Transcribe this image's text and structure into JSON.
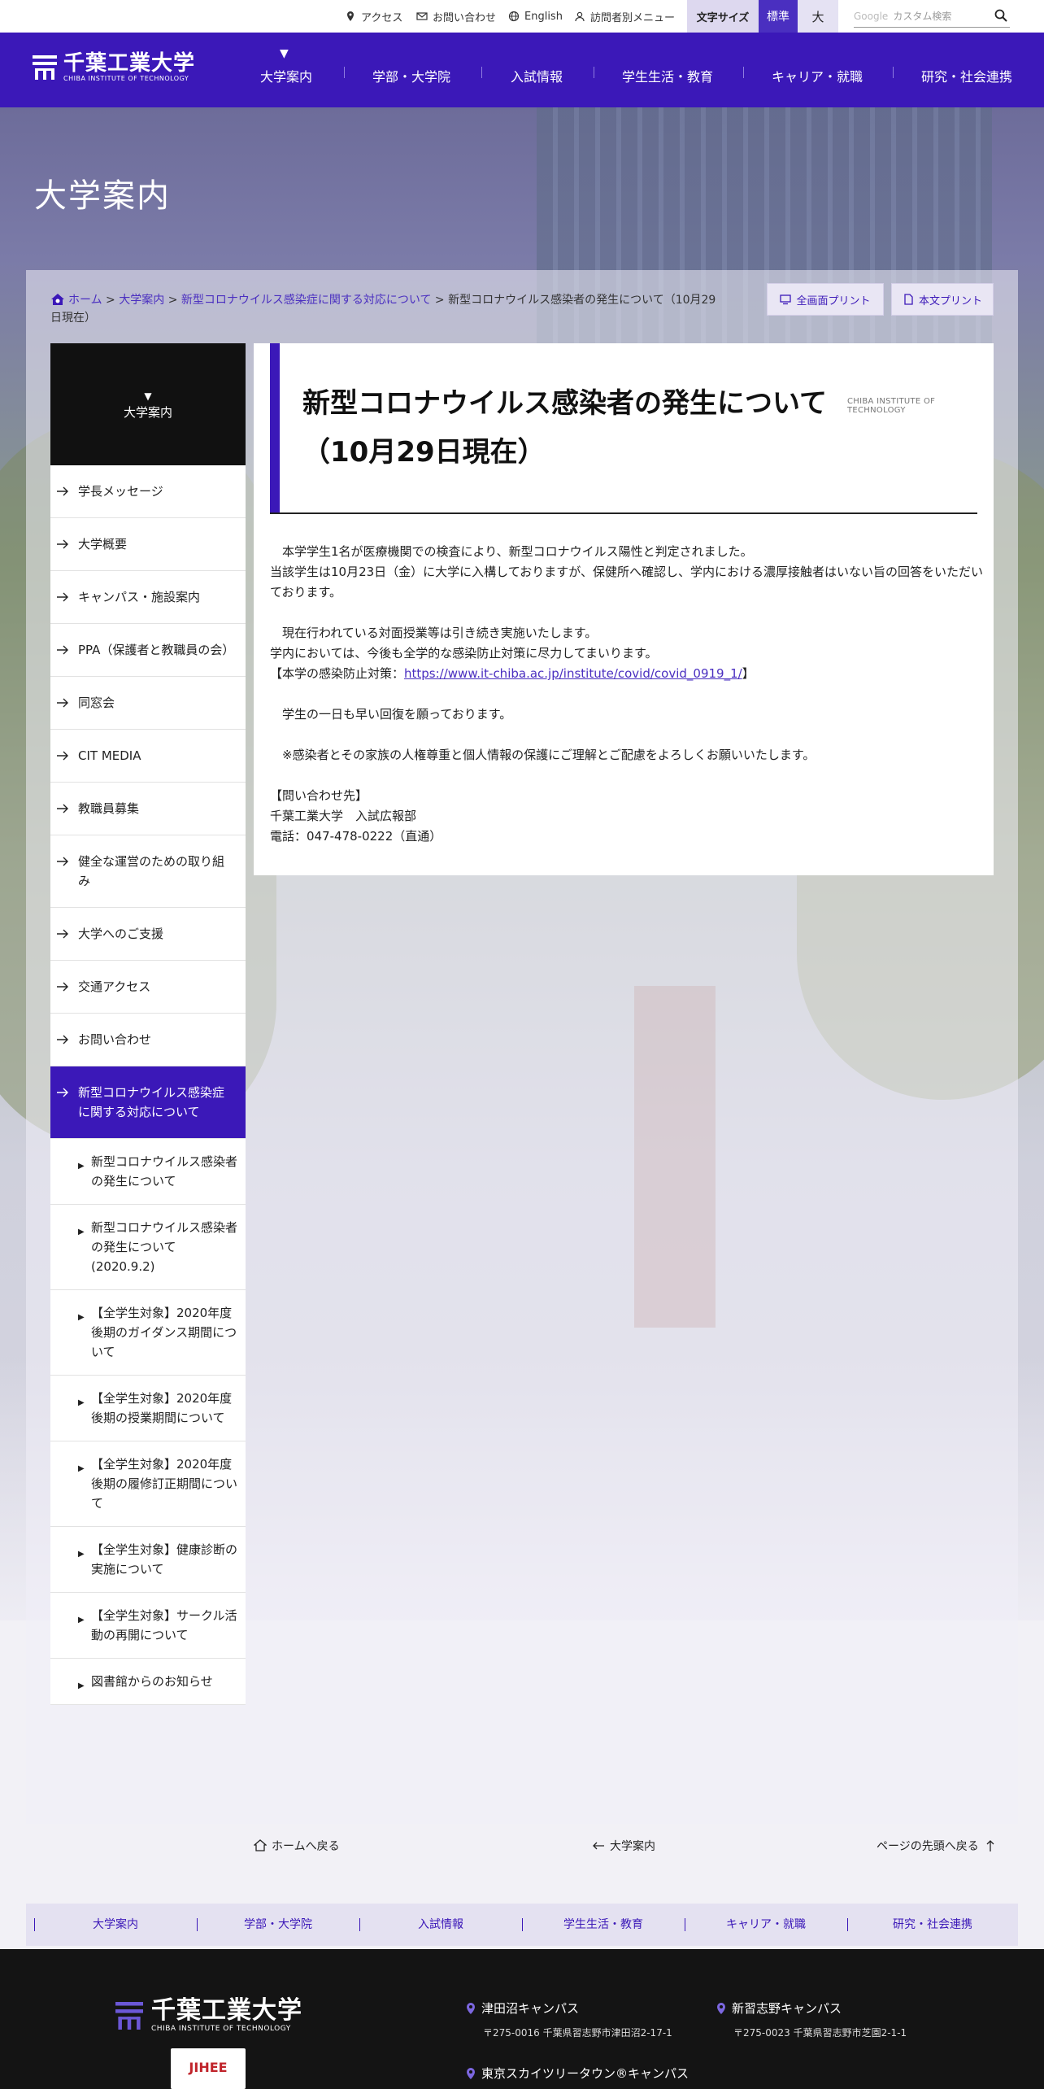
{
  "utility": {
    "access": "アクセス",
    "contact": "お問い合わせ",
    "english": "English",
    "visitor_menu": "訪問者別メニュー",
    "font_size_label": "文字サイズ",
    "font_std": "標準",
    "font_large": "大",
    "search_brand": "Google",
    "search_placeholder": "カスタム検索"
  },
  "brand": {
    "name": "千葉工業大学",
    "name_en": "CHIBA INSTITUTE OF TECHNOLOGY"
  },
  "nav": {
    "items": [
      "大学案内",
      "学部・大学院",
      "入試情報",
      "学生生活・教育",
      "キャリア・就職",
      "研究・社会連携"
    ]
  },
  "hero": {
    "title": "大学案内"
  },
  "breadcrumb": {
    "home": "ホーム",
    "sep": ">",
    "l1": "大学案内",
    "l2": "新型コロナウイルス感染症に関する対応について",
    "current": "新型コロナウイルス感染者の発生について（10月29日現在）"
  },
  "print": {
    "full": "全画面プリント",
    "body": "本文プリント"
  },
  "sidebar": {
    "title": "大学案内",
    "items": [
      "学長メッセージ",
      "大学概要",
      "キャンパス・施設案内",
      "PPA（保護者と教職員の会）",
      "同窓会",
      "CIT MEDIA",
      "教職員募集",
      "健全な運営のための取り組み",
      "大学へのご支援",
      "交通アクセス",
      "お問い合わせ"
    ],
    "active": "新型コロナウイルス感染症に関する対応について",
    "subs": [
      "新型コロナウイルス感染者の発生について",
      "新型コロナウイルス感染者の発生について(2020.9.2)",
      "【全学生対象】2020年度後期のガイダンス期間について",
      "【全学生対象】2020年度後期の授業期間について",
      "【全学生対象】2020年度後期の履修訂正期間について",
      "【全学生対象】健康診断の実施について",
      "【全学生対象】サークル活動の再開について",
      "図書館からのお知らせ"
    ]
  },
  "article": {
    "title": "新型コロナウイルス感染者の発生について（10月29日現在）",
    "tag": "CHIBA INSTITUTE OF TECHNOLOGY",
    "p1": "　本学学生1名が医療機関での検査により、新型コロナウイルス陽性と判定されました。",
    "p2": "当該学生は10月23日（金）に大学に入構しておりますが、保健所へ確認し、学内における濃厚接触者はいない旨の回答をいただいております。",
    "p3": "　現在行われている対面授業等は引き続き実施いたします。",
    "p4": "学内においては、今後も全学的な感染防止対策に尽力してまいります。",
    "p5_prefix": "【本学の感染防止対策：",
    "p5_link": "https://www.it-chiba.ac.jp/institute/covid/covid_0919_1/",
    "p5_suffix": "】",
    "p6": "　学生の一日も早い回復を願っております。",
    "p7": "　※感染者とその家族の人権尊重と個人情報の保護にご理解とご配慮をよろしくお願いいたします。",
    "c1": "【問い合わせ先】",
    "c2": "千葉工業大学　入試広報部",
    "c3": "電話：047-478-0222（直通）"
  },
  "bottom": {
    "home": "ホームへ戻る",
    "parent": "大学案内",
    "top": "ページの先頭へ戻る"
  },
  "footer": {
    "badge": "JIHEE",
    "campuses": [
      {
        "name": "津田沼キャンパス",
        "addr": "〒275-0016 千葉県習志野市津田沼2-17-1"
      },
      {
        "name": "新習志野キャンパス",
        "addr": "〒275-0023 千葉県習志野市芝園2-1-1"
      },
      {
        "name": "東京スカイツリータウン®キャンパス",
        "addr": ""
      }
    ]
  },
  "colors": {
    "brand": "#3b18b8",
    "footer": "#141414"
  }
}
